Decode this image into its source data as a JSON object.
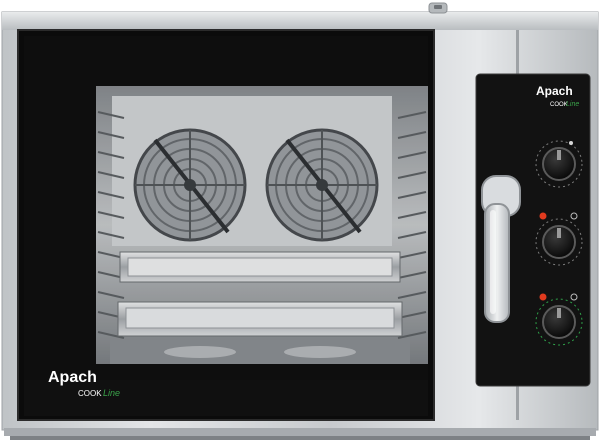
{
  "product": {
    "door_brand": {
      "name": "Apach",
      "sub_cook": "COOK",
      "sub_line": "Line"
    },
    "panel_brand": {
      "name": "Apach",
      "sub_cook": "COOK",
      "sub_line": "Line"
    }
  },
  "colors": {
    "steel": "#cfd2d4",
    "glass": "#0b0b0b",
    "panel": "#121212",
    "indicator": "#e03a1e",
    "line_accent": "#3aa34a",
    "handle": "#d9dcdf"
  },
  "icons": {
    "knob_top": "timer-knob-icon",
    "knob_middle": "temperature-knob-icon",
    "knob_bottom": "mode-knob-icon",
    "fan_left": "convection-fan-icon",
    "fan_right": "convection-fan-icon"
  }
}
